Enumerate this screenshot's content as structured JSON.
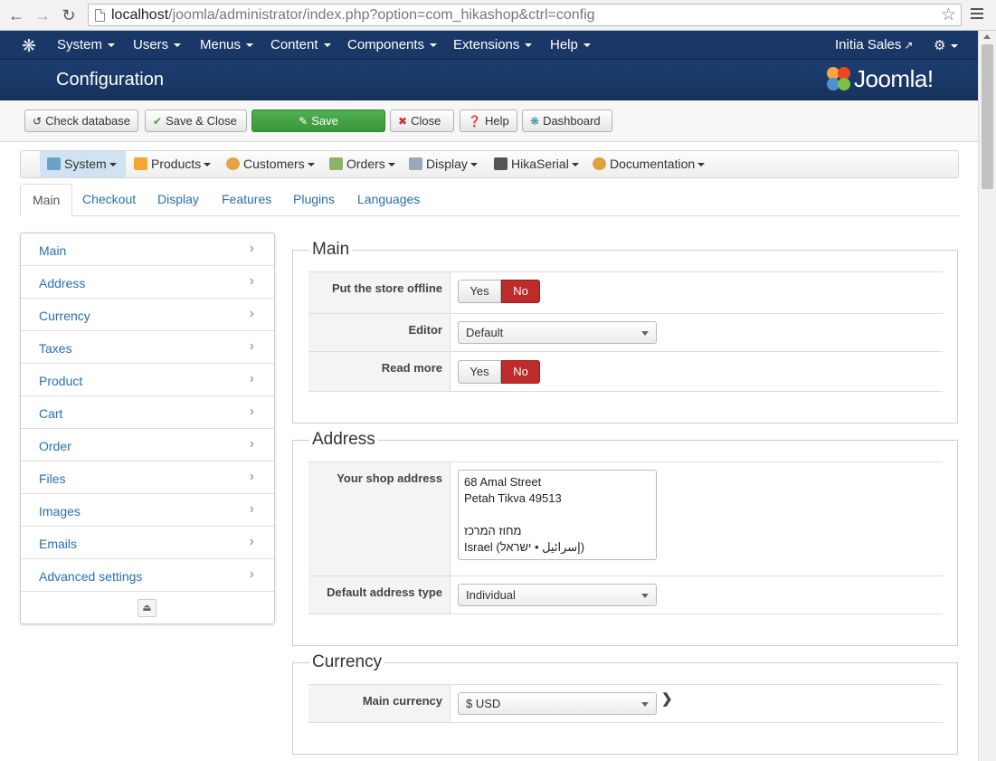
{
  "browser": {
    "url_host": "localhost",
    "url_path": "/joomla/administrator/index.php?option=com_hikashop&ctrl=config"
  },
  "topnav": {
    "items": [
      "System",
      "Users",
      "Menus",
      "Content",
      "Components",
      "Extensions",
      "Help"
    ],
    "site_name": "Initia Sales"
  },
  "header": {
    "title": "Configuration",
    "brand": "Joomla!"
  },
  "toolbar": {
    "check_database": "Check database",
    "save_close": "Save & Close",
    "save": "Save",
    "close": "Close",
    "help": "Help",
    "dashboard": "Dashboard"
  },
  "submenu": {
    "items": [
      "System",
      "Products",
      "Customers",
      "Orders",
      "Display",
      "HikaSerial",
      "Documentation"
    ]
  },
  "tabs": [
    "Main",
    "Checkout",
    "Display",
    "Features",
    "Plugins",
    "Languages"
  ],
  "leftnav": {
    "items": [
      "Main",
      "Address",
      "Currency",
      "Taxes",
      "Product",
      "Cart",
      "Order",
      "Files",
      "Images",
      "Emails",
      "Advanced settings"
    ]
  },
  "sections": {
    "main": {
      "legend": "Main",
      "offline_label": "Put the store offline",
      "editor_label": "Editor",
      "editor_value": "Default",
      "readmore_label": "Read more",
      "yes": "Yes",
      "no": "No",
      "offline_value": "No",
      "readmore_value": "No"
    },
    "address": {
      "legend": "Address",
      "shop_address_label": "Your shop address",
      "shop_address_lines": [
        "68 Amal Street",
        "Petah Tikva 49513",
        "",
        "מחוז המרכז",
        "Israel (إسرائيل • ישראל)"
      ],
      "default_type_label": "Default address type",
      "default_type_value": "Individual"
    },
    "currency": {
      "legend": "Currency",
      "main_currency_label": "Main currency",
      "main_currency_value": "$ USD"
    }
  },
  "colors": {
    "topnav_bg": "#1a3867",
    "save_green": "#46a546",
    "no_red": "#bd2b2b",
    "link_blue": "#2a6fad"
  }
}
